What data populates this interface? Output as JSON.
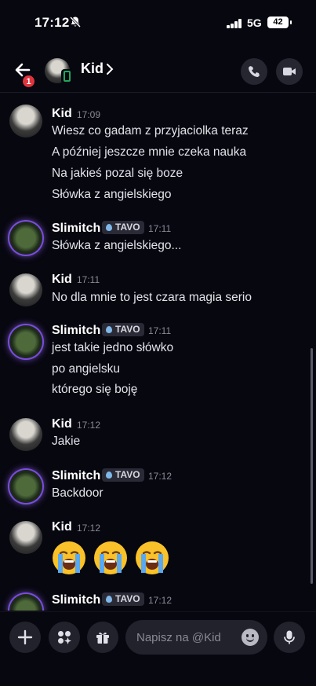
{
  "status_bar": {
    "time": "17:12",
    "network": "5G",
    "battery": "42"
  },
  "header": {
    "title": "Kid",
    "back_badge": "1"
  },
  "messages": [
    {
      "author": "Kid",
      "time": "17:09",
      "lines": [
        "Wiesz co gadam z przyjaciolka teraz",
        "A później jeszcze mnie czeka nauka",
        "Na jakieś pozal się boze",
        "Słówka z angielskiego"
      ]
    },
    {
      "author": "Slimitch",
      "tag": "TAVO",
      "time": "17:11",
      "lines": [
        "Słówka z angielskiego..."
      ]
    },
    {
      "author": "Kid",
      "time": "17:11",
      "lines": [
        "No dla mnie to jest czara magia serio"
      ]
    },
    {
      "author": "Slimitch",
      "tag": "TAVO",
      "time": "17:11",
      "lines": [
        "jest takie jedno słówko",
        "po angielsku",
        "którego się boję"
      ]
    },
    {
      "author": "Kid",
      "time": "17:12",
      "lines": [
        "Jakie"
      ]
    },
    {
      "author": "Slimitch",
      "tag": "TAVO",
      "time": "17:12",
      "lines": [
        "Backdoor"
      ]
    },
    {
      "author": "Kid",
      "time": "17:12",
      "emoji": [
        "loudly-crying-face",
        "loudly-crying-face",
        "loudly-crying-face"
      ]
    },
    {
      "author": "Slimitch",
      "tag": "TAVO",
      "time": "17:12"
    }
  ],
  "composer": {
    "placeholder": "Napisz na @Kid"
  },
  "icons": {
    "back": "arrow-left-icon",
    "call": "phone-icon",
    "video": "video-camera-icon",
    "plus": "plus-icon",
    "apps": "apps-icon",
    "gift": "gift-icon",
    "emoji": "smiley-icon",
    "mic": "microphone-icon"
  },
  "colors": {
    "background": "#070710",
    "badge": "#e0343c",
    "mobile_indicator": "#23a55a",
    "accent_glow": "#7b4ce0"
  }
}
